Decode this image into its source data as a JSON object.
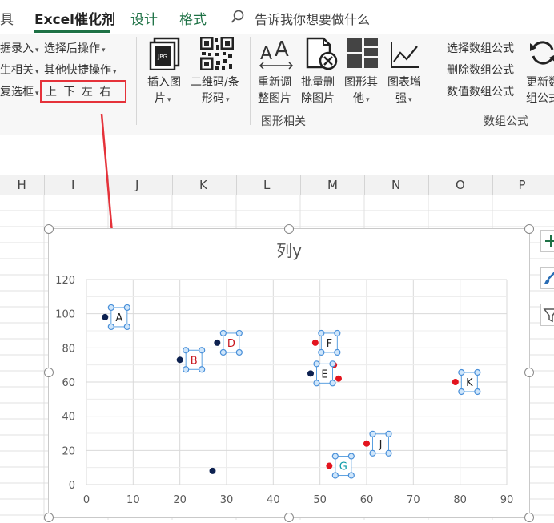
{
  "ribbon_tabs": {
    "partial_left": "具",
    "active": "Excel催化剂",
    "design": "设计",
    "format": "格式",
    "tell_me": "告诉我你想要做什么"
  },
  "ribbon_left": {
    "row1_a": "据录入",
    "row1_b": "选择后操作",
    "row2_a": "生相关",
    "row2_b": "其他快捷操作",
    "row3_a": "复选框",
    "directions": "上 下 左 右"
  },
  "graphics_group": {
    "insert_image_1": "插入图",
    "insert_image_2": "片",
    "qrcode_1": "二维码/条",
    "qrcode_2": "形码",
    "reorder_1": "重新调",
    "reorder_2": "整图片",
    "batch_delete_1": "批量删",
    "batch_delete_2": "除图片",
    "shape_other_1": "图形其",
    "shape_other_2": "他",
    "chart_enhance_1": "图表增",
    "chart_enhance_2": "强",
    "group_label": "图形相关"
  },
  "array_group": {
    "select_array": "选择数组公式",
    "delete_array": "删除数组公式",
    "value_array": "数值数组公式",
    "update_1": "更新数",
    "update_2": "组公式",
    "group_label": "数组公式"
  },
  "columns": [
    "H",
    "I",
    "J",
    "K",
    "L",
    "M",
    "N",
    "O",
    "P"
  ],
  "chart_data": {
    "type": "scatter",
    "title": "列y",
    "xlim": [
      0,
      90
    ],
    "ylim": [
      0,
      120
    ],
    "x_ticks": [
      0,
      10,
      20,
      30,
      40,
      50,
      60,
      70,
      80,
      90
    ],
    "y_ticks": [
      0,
      20,
      40,
      60,
      80,
      100,
      120
    ],
    "grid": true,
    "points": [
      {
        "x": 4,
        "y": 98,
        "color": "#0d2150"
      },
      {
        "x": 20,
        "y": 73,
        "color": "#0d2150"
      },
      {
        "x": 28,
        "y": 83,
        "color": "#0d2150"
      },
      {
        "x": 27,
        "y": 8,
        "color": "#0d2150"
      },
      {
        "x": 48,
        "y": 65,
        "color": "#0d2150"
      },
      {
        "x": 49,
        "y": 83,
        "color": "#e3141e"
      },
      {
        "x": 53,
        "y": 70,
        "color": "#e3141e"
      },
      {
        "x": 54,
        "y": 62,
        "color": "#e3141e"
      },
      {
        "x": 60,
        "y": 24,
        "color": "#e3141e"
      },
      {
        "x": 52,
        "y": 11,
        "color": "#e3141e"
      },
      {
        "x": 79,
        "y": 60,
        "color": "#e3141e"
      }
    ],
    "labels": [
      {
        "text": "A",
        "x": 7,
        "y": 98,
        "color": "#222222"
      },
      {
        "text": "B",
        "x": 23,
        "y": 73,
        "color": "#c8161e"
      },
      {
        "text": "D",
        "x": 31,
        "y": 83,
        "color": "#c8161e"
      },
      {
        "text": "F",
        "x": 52,
        "y": 83,
        "color": "#222222"
      },
      {
        "text": "E",
        "x": 51,
        "y": 65,
        "color": "#222222"
      },
      {
        "text": "J",
        "x": 63,
        "y": 24,
        "color": "#222222"
      },
      {
        "text": "G",
        "x": 55,
        "y": 11,
        "color": "#0b9aa8"
      },
      {
        "text": "K",
        "x": 82,
        "y": 60,
        "color": "#222222"
      }
    ]
  },
  "colors": {
    "accent": "#1e7145",
    "annotation": "#e5323a"
  }
}
